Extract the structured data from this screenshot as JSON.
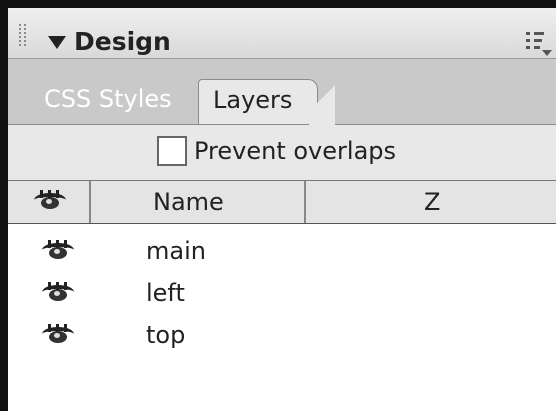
{
  "panel": {
    "title": "Design"
  },
  "tabs": [
    {
      "label": "CSS Styles",
      "active": false
    },
    {
      "label": "Layers",
      "active": true
    }
  ],
  "options": {
    "prevent_overlaps_label": "Prevent overlaps",
    "prevent_overlaps_checked": false
  },
  "columns": {
    "visibility_icon": "eye-icon",
    "name": "Name",
    "z": "Z"
  },
  "layers": [
    {
      "name": "main",
      "icon": "eye-icon"
    },
    {
      "name": "left",
      "icon": "eye-icon"
    },
    {
      "name": "top",
      "icon": "eye-icon"
    }
  ]
}
